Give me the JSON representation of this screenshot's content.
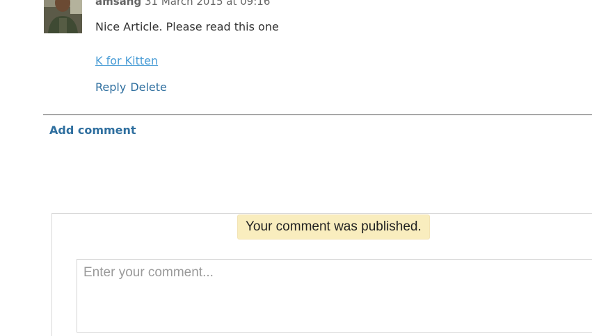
{
  "comment": {
    "author": "amsang",
    "timestamp": "31 March 2015 at 09:16",
    "text": "Nice Article. Please read this one",
    "link_text": "K for Kitten",
    "reply_label": "Reply",
    "delete_label": "Delete"
  },
  "add_comment_label": "Add comment",
  "form": {
    "published_message": "Your comment was published.",
    "input_placeholder": "Enter your comment...",
    "input_value": ""
  }
}
